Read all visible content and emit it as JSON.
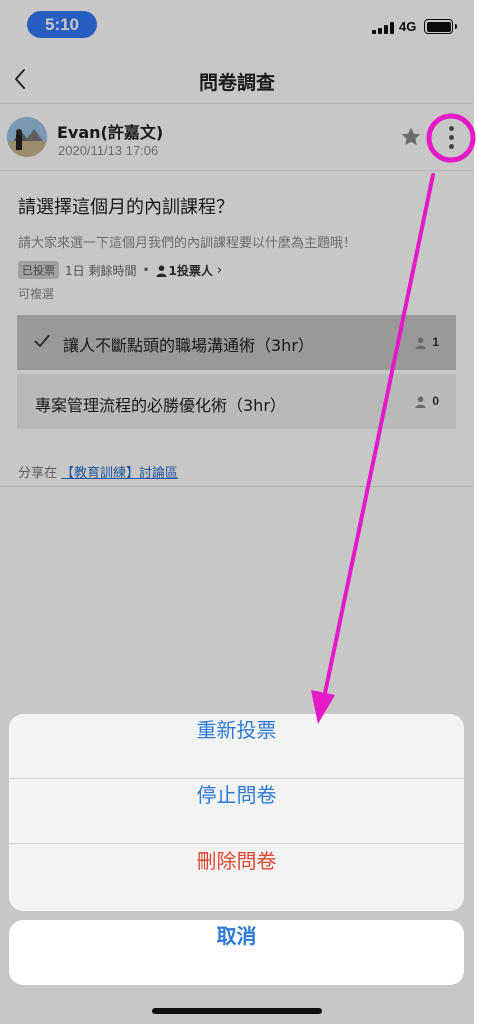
{
  "status_bar": {
    "time": "5:10",
    "network": "4G"
  },
  "nav": {
    "title": "問卷調查"
  },
  "author": {
    "name": "Evan(許嘉文)",
    "date": "2020/11/13 17:06"
  },
  "poll": {
    "question": "請選擇這個月的內訓課程？",
    "description": "請大家來選一下這個月我們的內訓課程要以什麼為主題哦！",
    "voted_badge": "已投票",
    "time_left": "1日 剩餘時間",
    "voters": "1投票人",
    "multi_select": "可複選",
    "options": [
      {
        "label": "讓人不斷點頭的職場溝通術（3hr）",
        "count": "1",
        "selected": true
      },
      {
        "label": "專案管理流程的必勝優化術（3hr）",
        "count": "0",
        "selected": false
      }
    ]
  },
  "share": {
    "prefix": "分享在",
    "link": "【教育訓練】討論區"
  },
  "action_sheet": {
    "revote": "重新投票",
    "stop": "停止問卷",
    "delete": "刪除問卷",
    "cancel": "取消"
  },
  "colors": {
    "accent": "#2d7ad6",
    "destructive": "#e0462f",
    "annotation": "#e619c8",
    "time_pill": "#3478f6"
  }
}
